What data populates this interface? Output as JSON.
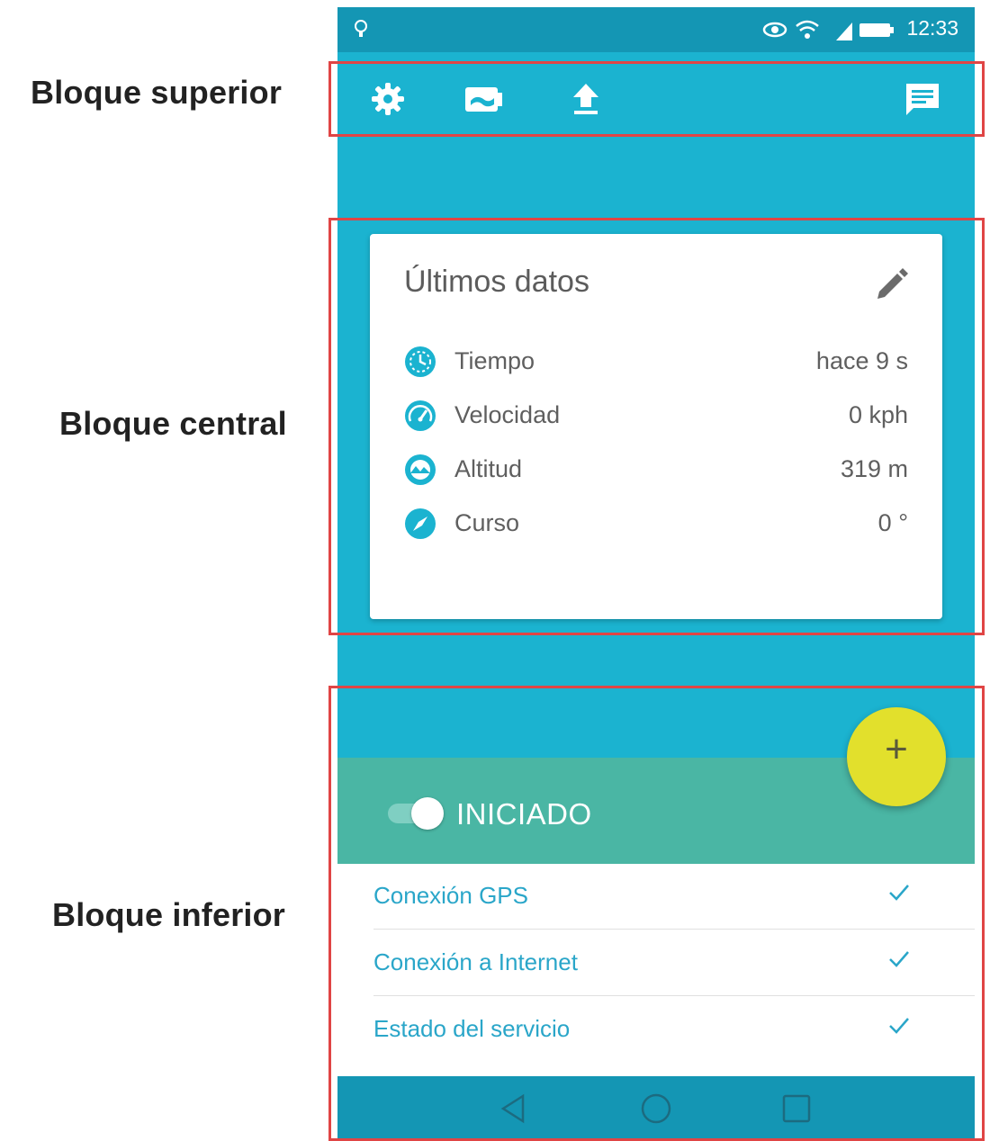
{
  "annotations": {
    "top_label": "Bloque superior",
    "center_label": "Bloque central",
    "bottom_label": "Bloque inferior"
  },
  "colors": {
    "primary": "#1bb3d0",
    "status_bar": "#1496b4",
    "accent_green": "#4ab6a4",
    "fab": "#e2e02c",
    "link": "#2aa6c9",
    "highlight_box": "#e04545"
  },
  "status_bar": {
    "time": "12:33",
    "icons": [
      "notification-icon",
      "eye-icon",
      "wifi-icon",
      "signal-icon",
      "battery-icon"
    ]
  },
  "toolbar": {
    "icons": [
      "settings-icon",
      "camera-icon",
      "upload-icon",
      "message-icon"
    ]
  },
  "card": {
    "title": "Últimos datos",
    "rows": [
      {
        "label": "Tiempo",
        "value": "hace 9 s",
        "icon": "clock-icon"
      },
      {
        "label": "Velocidad",
        "value": "0 kph",
        "icon": "speedometer-icon"
      },
      {
        "label": "Altitud",
        "value": "319 m",
        "icon": "altitude-icon"
      },
      {
        "label": "Curso",
        "value": "0 °",
        "icon": "compass-icon"
      }
    ]
  },
  "service": {
    "state_label": "INICIADO",
    "switch_on": true,
    "fab_label": "+"
  },
  "checks": [
    {
      "label": "Conexión GPS",
      "ok": true
    },
    {
      "label": "Conexión a Internet",
      "ok": true
    },
    {
      "label": "Estado del servicio",
      "ok": true
    }
  ],
  "nav": [
    "back-icon",
    "home-icon",
    "recents-icon"
  ]
}
